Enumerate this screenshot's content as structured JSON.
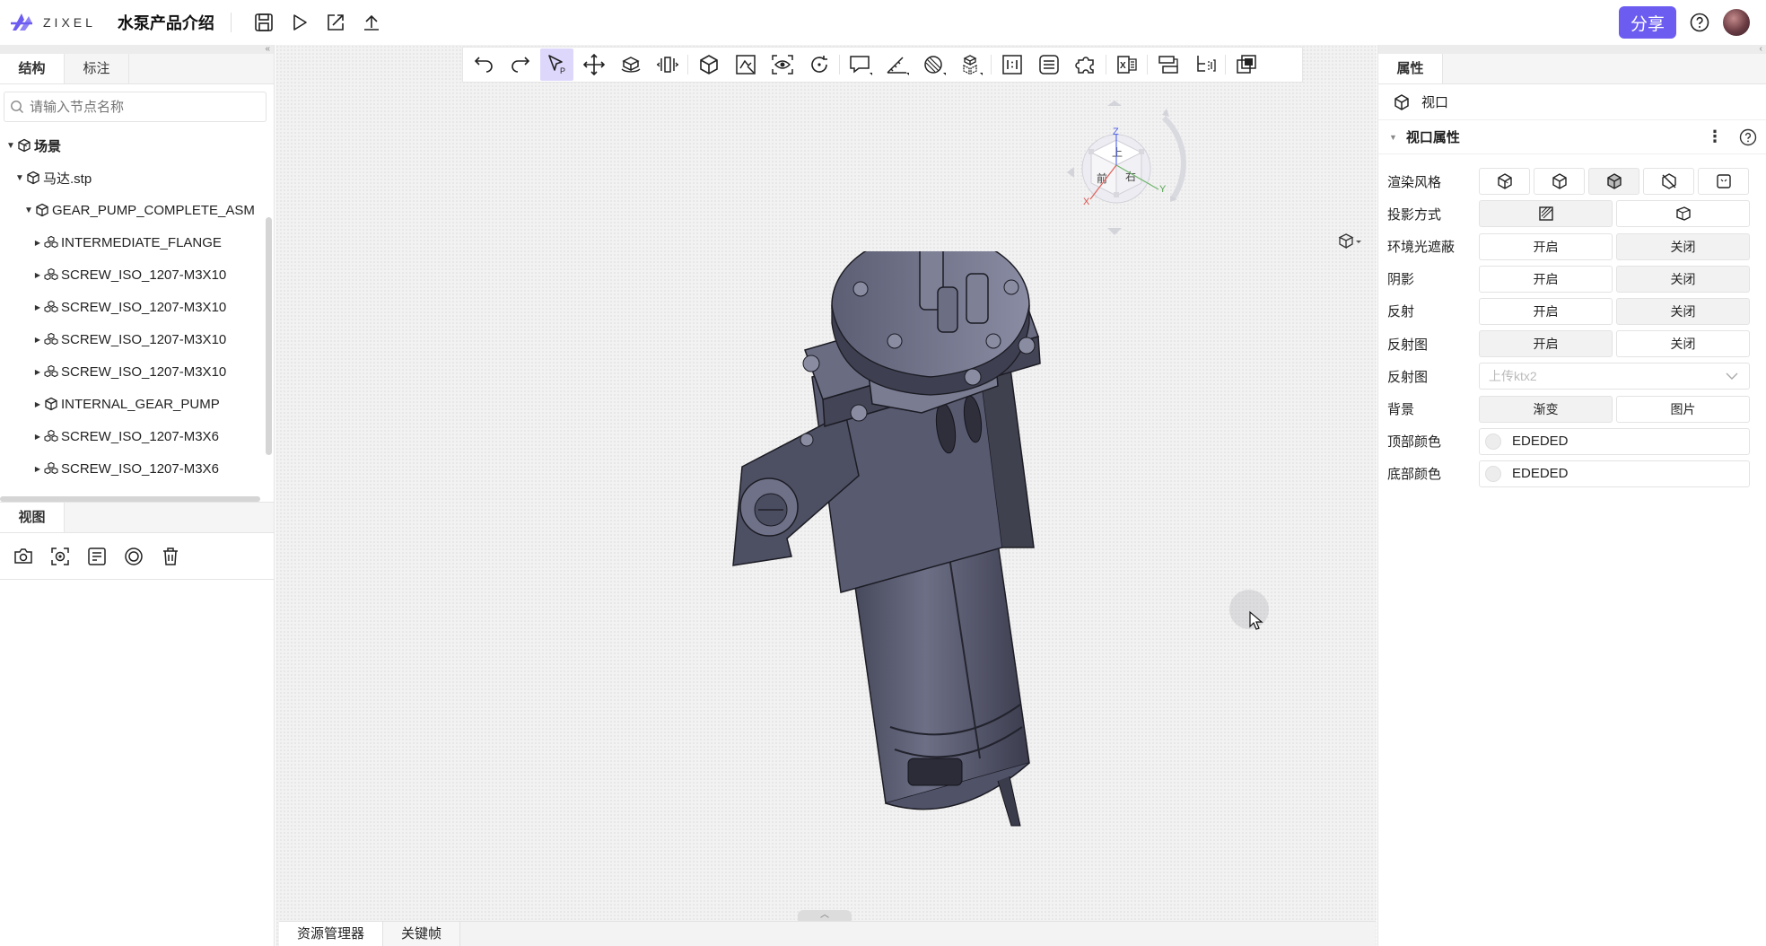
{
  "header": {
    "logo_text": "ZIXEL",
    "project_title": "水泵产品介绍",
    "share_label": "分享"
  },
  "left_panel": {
    "tabs": [
      "结构",
      "标注"
    ],
    "search_placeholder": "请输入节点名称",
    "tree": [
      {
        "label": "场景",
        "level": 0,
        "icon": "scene-icon",
        "expanded": true
      },
      {
        "label": "马达.stp",
        "level": 1,
        "icon": "part-cube-icon",
        "expanded": true
      },
      {
        "label": "GEAR_PUMP_COMPLETE_ASM",
        "level": 2,
        "icon": "part-cube-icon",
        "expanded": true
      },
      {
        "label": "INTERMEDIATE_FLANGE",
        "level": 3,
        "icon": "assembly-icon",
        "expanded": false
      },
      {
        "label": "SCREW_ISO_1207-M3X10",
        "level": 3,
        "icon": "assembly-icon",
        "expanded": false
      },
      {
        "label": "SCREW_ISO_1207-M3X10",
        "level": 3,
        "icon": "assembly-icon",
        "expanded": false
      },
      {
        "label": "SCREW_ISO_1207-M3X10",
        "level": 3,
        "icon": "assembly-icon",
        "expanded": false
      },
      {
        "label": "SCREW_ISO_1207-M3X10",
        "level": 3,
        "icon": "assembly-icon",
        "expanded": false
      },
      {
        "label": "INTERNAL_GEAR_PUMP",
        "level": 3,
        "icon": "part-cube-icon",
        "expanded": false
      },
      {
        "label": "SCREW_ISO_1207-M3X6",
        "level": 3,
        "icon": "assembly-icon",
        "expanded": false
      },
      {
        "label": "SCREW_ISO_1207-M3X6",
        "level": 3,
        "icon": "assembly-icon",
        "expanded": false
      }
    ],
    "view_tab": "视图"
  },
  "viewport": {
    "viewcube": {
      "axis_z": "Z",
      "axis_y": "Y",
      "axis_x": "X",
      "face_top": "上",
      "face_front": "前",
      "face_right": "右"
    },
    "bottom_tabs": [
      "资源管理器",
      "关键帧"
    ]
  },
  "right_panel": {
    "tab": "属性",
    "object_label": "视口",
    "section_title": "视口属性",
    "props": {
      "render_style": "渲染风格",
      "projection": "投影方式",
      "ao": "环境光遮蔽",
      "shadow": "阴影",
      "reflection": "反射",
      "reflection_map": "反射图",
      "reflection_map2": "反射图",
      "background": "背景",
      "top_color": "顶部颜色",
      "bottom_color": "底部颜色"
    },
    "on_label": "开启",
    "off_label": "关闭",
    "upload_placeholder": "上传ktx2",
    "bg_gradient": "渐变",
    "bg_image": "图片",
    "top_color_value": "EDEDED",
    "bottom_color_value": "EDEDED"
  },
  "colors": {
    "accent": "#6c5cf0",
    "selected_tool": "#ddd8fb"
  }
}
